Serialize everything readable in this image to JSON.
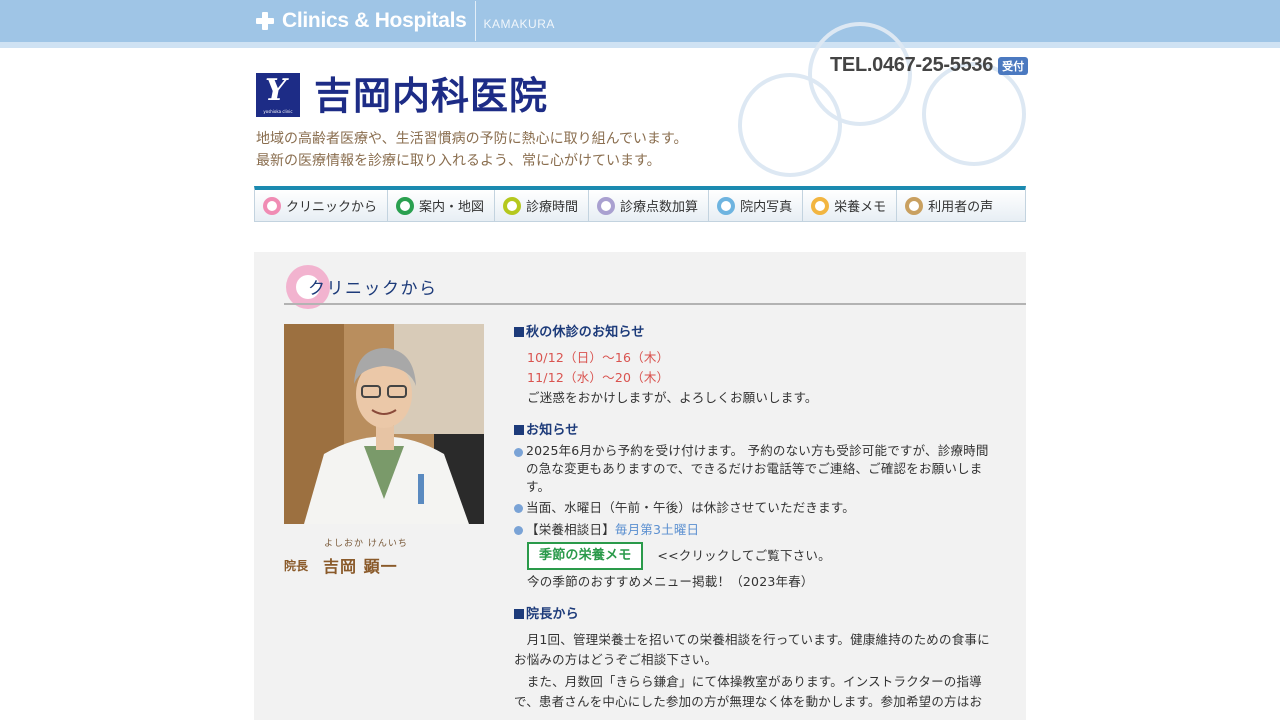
{
  "topbar": {
    "brand": "Clinics & Hospitals",
    "city": "KAMAKURA"
  },
  "header": {
    "tel": "TEL.0467-25-5536",
    "tel_badge": "受付",
    "logo_text": "yoshioka clinic",
    "clinic_name": "吉岡内科医院",
    "tagline_1": "地域の高齢者医療や、生活習慣病の予防に熱心に取り組んでいます。",
    "tagline_2": "最新の医療情報を診療に取り入れるよう、常に心がけています。"
  },
  "nav": [
    {
      "label": "クリニックから",
      "color": "#f08cb4"
    },
    {
      "label": "案内・地図",
      "color": "#2aa050"
    },
    {
      "label": "診療時間",
      "color": "#b5c81e"
    },
    {
      "label": "診療点数加算",
      "color": "#a9a0d0"
    },
    {
      "label": "院内写真",
      "color": "#6eb4e0"
    },
    {
      "label": "栄養メモ",
      "color": "#f2b540"
    },
    {
      "label": "利用者の声",
      "color": "#c9a060"
    }
  ],
  "section": {
    "title": "クリニックから",
    "furigana": "よしおか けんいち",
    "role": "院長",
    "name": "吉岡 顕一"
  },
  "notice_holiday": {
    "heading": "秋の休診のお知らせ",
    "date_1": "10/12（日）～16（木）",
    "date_2": "11/12（水）～20（木）",
    "note": "ご迷惑をおかけしますが、よろしくお願いします。"
  },
  "notice": {
    "heading": "お知らせ",
    "item_1": "2025年6月から予約を受け付けます。 予約のない方も受診可能ですが、診療時間の急な変更もありますので、できるだけお電話等でご連絡、ご確認をお願いします。",
    "item_2": "当面、水曜日（午前・午後）は休診させていただきます。",
    "item_3_prefix": "【栄養相談日】",
    "item_3_day": "毎月第3土曜日",
    "memo_button": "季節の栄養メモ",
    "memo_note": "<<クリックしてご覧下さい。",
    "memo_sub": "今の季節のおすすめメニュー掲載！（2023年春）"
  },
  "director": {
    "heading": "院長から",
    "para_1": "　月1回、管理栄養士を招いての栄養相談を行っています。健康維持のための食事にお悩みの方はどうぞご相談下さい。",
    "para_2": "　また、月数回「きらら鎌倉」にて体操教室があります。インストラクターの指導で、患者さんを中心にした参加の方が無理なく体を動かします。参加希望の方はお"
  }
}
